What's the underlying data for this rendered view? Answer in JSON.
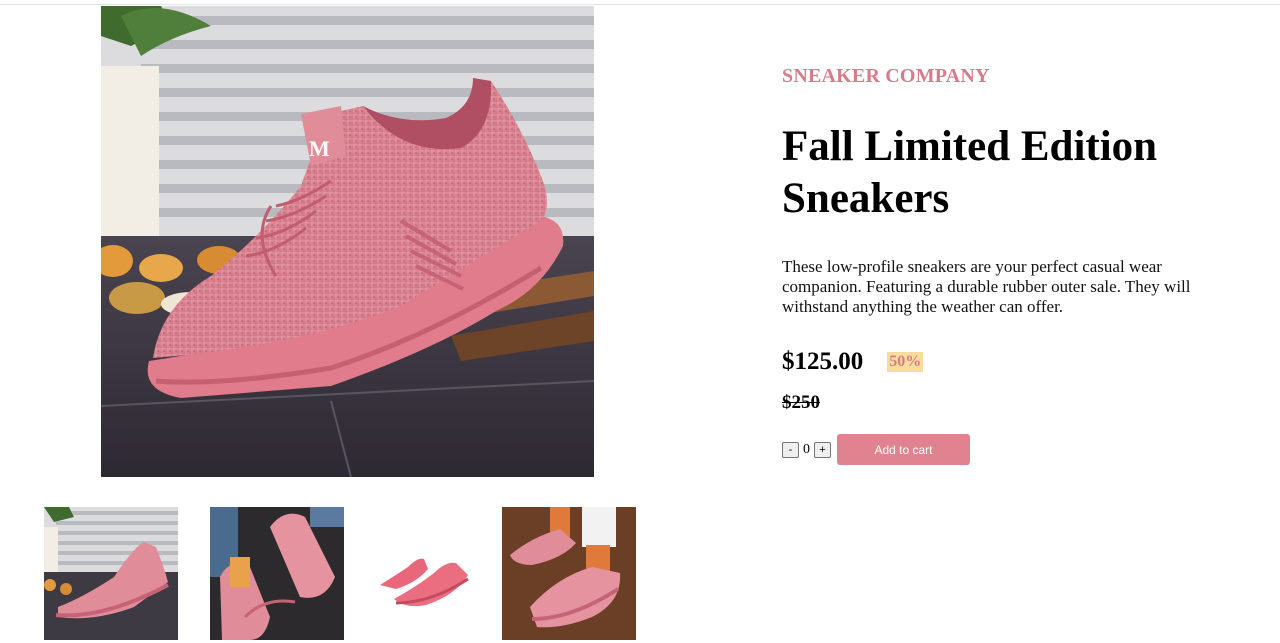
{
  "product": {
    "brand": "SNEAKER COMPANY",
    "title": "Fall Limited Edition Sneakers",
    "description": "These low-profile sneakers are your perfect casual wear companion. Featuring a durable rubber outer sale. They will withstand anything the weather can offer.",
    "price": "$125.00",
    "discount": "50%",
    "original_price": "$250"
  },
  "cart": {
    "decrement_label": "-",
    "quantity": "0",
    "increment_label": "+",
    "add_to_cart_label": "Add to cart"
  },
  "gallery": {
    "thumbnails": [
      "thumbnail-1",
      "thumbnail-2",
      "thumbnail-3",
      "thumbnail-4"
    ]
  },
  "colors": {
    "accent": "#d77b8b",
    "button": "#e0828f",
    "discount_bg": "#f7dc9b",
    "shoe": "#d9788a"
  }
}
